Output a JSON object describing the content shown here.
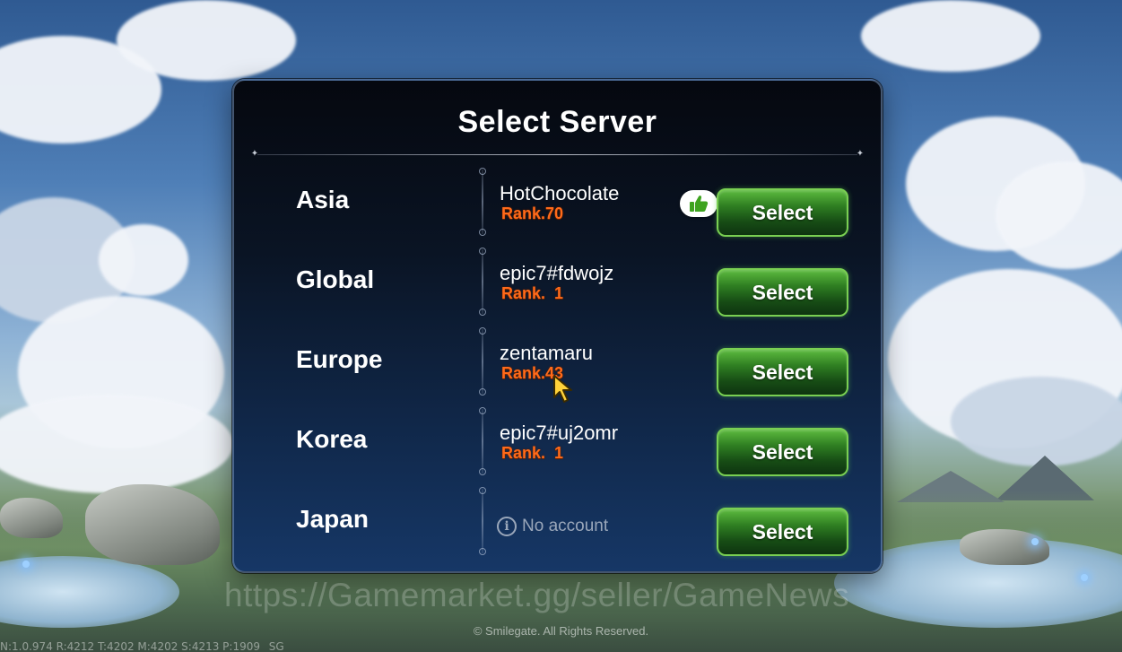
{
  "dialog": {
    "title": "Select Server"
  },
  "servers": [
    {
      "region": "Asia",
      "account": "HotChocolate",
      "rank": "Rank.70",
      "button": "Select",
      "recommended": true
    },
    {
      "region": "Global",
      "account": "epic7#fdwojz",
      "rank": "Rank.  1",
      "button": "Select"
    },
    {
      "region": "Europe",
      "account": "zentamaru",
      "rank": "Rank.43",
      "button": "Select"
    },
    {
      "region": "Korea",
      "account": "epic7#uj2omr",
      "rank": "Rank.  1",
      "button": "Select"
    },
    {
      "region": "Japan",
      "no_account": "No account",
      "button": "Select"
    }
  ],
  "footer": {
    "watermark": "https://Gamemarket.gg/seller/GameNews",
    "copyright": "© Smilegate. All Rights Reserved.",
    "debug": "N:1.0.974 R:4212 T:4202 M:4202 S:4213 P:1909 _SG"
  },
  "colors": {
    "rank": "#ff6a1a",
    "select_button": "#2f7f22",
    "recommend_icon": "#3ea31f"
  },
  "icons": {
    "recommend": "thumbs-up-icon",
    "info": "info-icon",
    "cursor": "mouse-pointer-icon"
  }
}
